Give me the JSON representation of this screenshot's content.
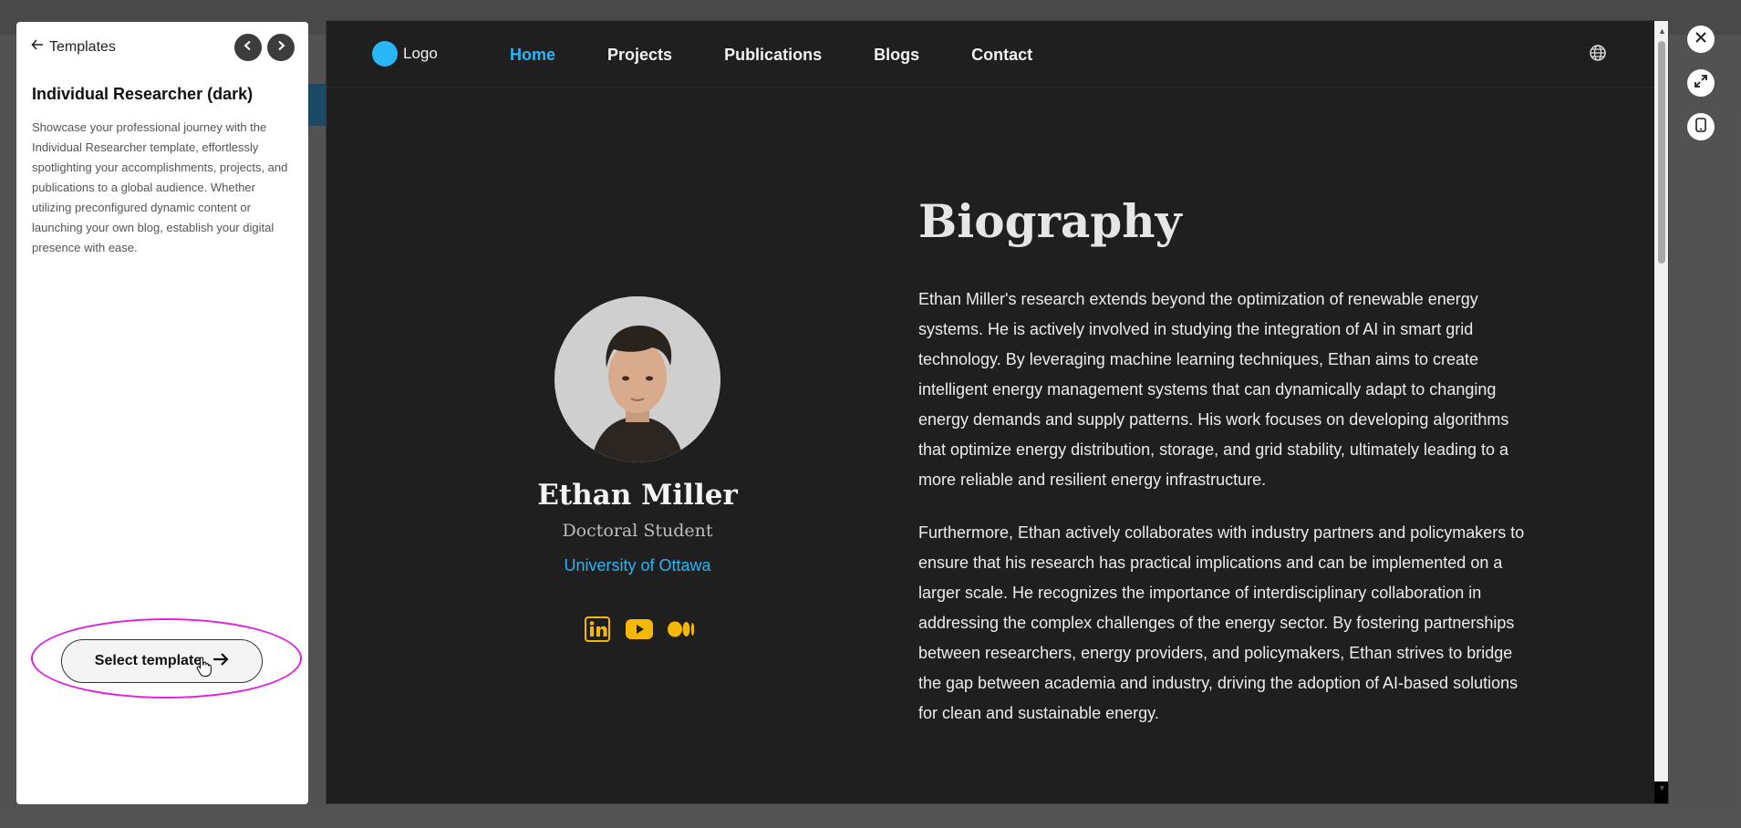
{
  "panel": {
    "back_label": "Templates",
    "title": "Individual Researcher (dark)",
    "description": "Showcase your professional journey with the Individual Researcher template, effortlessly spotlighting your accomplishments, projects, and publications to a global audience. Whether utilizing preconfigured dynamic content or launching your own blog, establish your digital presence with ease.",
    "select_label": "Select template"
  },
  "site": {
    "logo_text": "Logo",
    "nav": [
      "Home",
      "Projects",
      "Publications",
      "Blogs",
      "Contact"
    ],
    "active_nav": "Home",
    "profile": {
      "name": "Ethan Miller",
      "role": "Doctoral Student",
      "university": "University of Ottawa",
      "socials": [
        "linkedin-icon",
        "youtube-icon",
        "medium-icon"
      ]
    },
    "bio": {
      "heading": "Biography",
      "paragraphs": [
        "Ethan Miller's research extends beyond the optimization of renewable energy systems. He is actively involved in studying the integration of AI in smart grid technology. By leveraging machine learning techniques, Ethan aims to create intelligent energy management systems that can dynamically adapt to changing energy demands and supply patterns. His work focuses on developing algorithms that optimize energy distribution, storage, and grid stability, ultimately leading to a more reliable and resilient energy infrastructure.",
        "Furthermore, Ethan actively collaborates with industry partners and policymakers to ensure that his research has practical implications and can be implemented on a larger scale. He recognizes the importance of interdisciplinary collaboration in addressing the complex challenges of the energy sector. By fostering partnerships between researchers, energy providers, and policymakers, Ethan strives to bridge the gap between academia and industry, driving the adoption of AI-based solutions for clean and sustainable energy."
      ]
    }
  },
  "colors": {
    "accent": "#29b6f6",
    "social_icon": "#f5b800",
    "highlight": "#e01ee0",
    "preview_bg": "#1f1f1f"
  },
  "controls": [
    "close-icon",
    "expand-icon",
    "mobile-icon"
  ]
}
